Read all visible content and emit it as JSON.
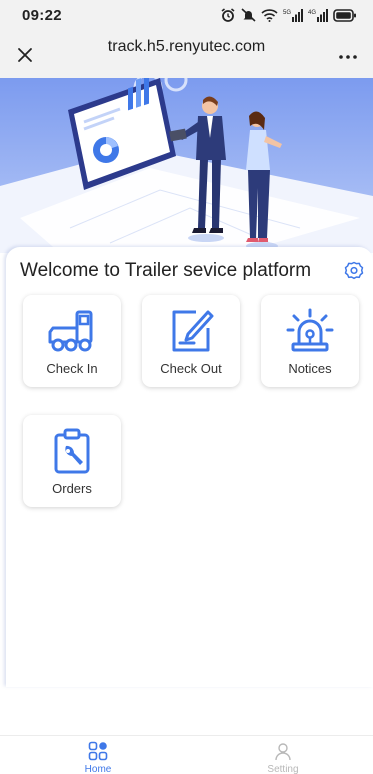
{
  "status_bar": {
    "time": "09:22",
    "icons": [
      "alarm-icon",
      "mute-icon",
      "wifi-icon",
      "signal-5g-icon",
      "signal-4g-icon",
      "battery-icon"
    ],
    "network_labels": [
      "5G",
      "4G"
    ]
  },
  "browser": {
    "url": "track.h5.renyutec.com",
    "close_icon": "close-icon",
    "more_icon": "more-icon"
  },
  "hero": {
    "image": "business-analytics-illustration"
  },
  "welcome": {
    "text": "Welcome to Trailer sevice platform",
    "icon": "gear-icon"
  },
  "menu": [
    {
      "label": "Check In",
      "icon": "truck-icon"
    },
    {
      "label": "Check Out",
      "icon": "edit-document-icon"
    },
    {
      "label": "Notices",
      "icon": "alarm-light-icon"
    },
    {
      "label": "Orders",
      "icon": "clipboard-wrench-icon"
    }
  ],
  "tabbar": {
    "tabs": [
      {
        "label": "Home",
        "icon": "home-grid-icon",
        "active": true
      },
      {
        "label": "Setting",
        "icon": "person-icon",
        "active": false
      }
    ]
  },
  "colors": {
    "accent": "#3f78e8",
    "hero_bg": "#7f9ff0",
    "inactive": "#b8b8b8"
  }
}
